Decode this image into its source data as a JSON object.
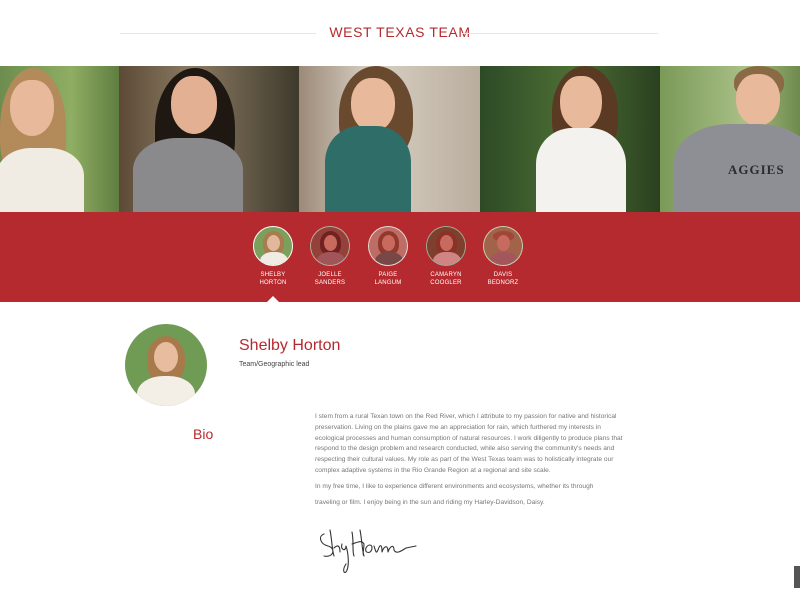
{
  "header": {
    "title": "WEST TEXAS TEAM"
  },
  "colors": {
    "accent": "#b52a2e"
  },
  "team": [
    {
      "first": "SHELBY",
      "last": "HORTON",
      "active": true
    },
    {
      "first": "JOELLE",
      "last": "SANDERS",
      "active": false
    },
    {
      "first": "PAIGE",
      "last": "LANGUM",
      "active": false
    },
    {
      "first": "CAMARYN",
      "last": "COOGLER",
      "active": false
    },
    {
      "first": "DAVIS",
      "last": "BEDNORZ",
      "active": false
    }
  ],
  "profile": {
    "name": "Shelby Horton",
    "role": "Team/Geographic lead",
    "bio_label": "Bio",
    "bio_paragraphs": [
      "I stem from a rural Texan town on the Red River, which I attribute to my passion for native and historical preservation. Living on the plains gave me an appreciation for rain, which furthered my interests in ecological processes and human consumption of natural resources. I work diligently to produce plans that respond to the design problem and research conducted, while also serving the community's needs and respecting their cultural values. My role as part of the West Texas team was to holistically integrate our complex adaptive systems in the Rio Grande Region at a regional and site scale.",
      "In my free time, I like to experience different environments and ecosystems, whether its through",
      "traveling or film. I enjoy being in the sun and riding my Harley-Davidson, Daisy."
    ],
    "signature_text": "Shelby Horton"
  },
  "photo_shirt_text": "AGGIES"
}
